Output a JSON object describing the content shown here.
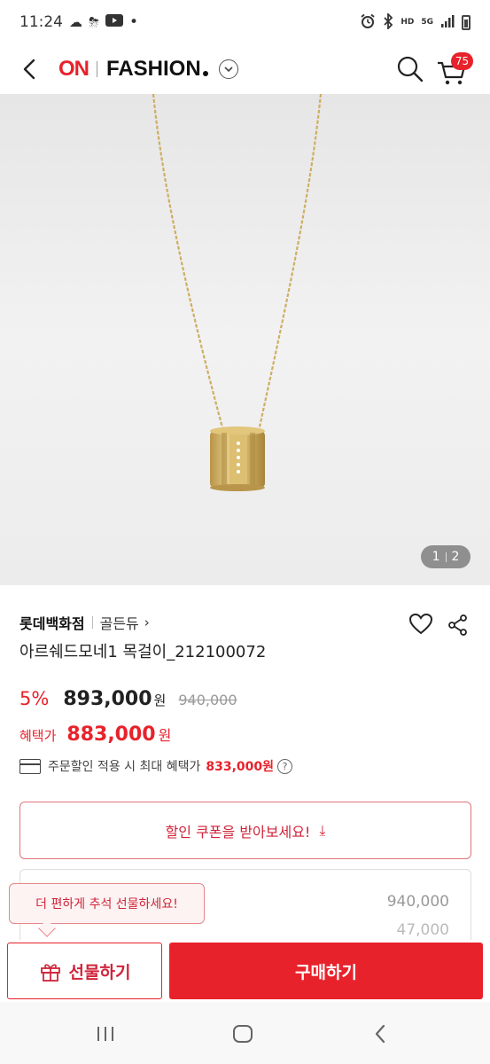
{
  "status_bar": {
    "time": "11:24",
    "left_icons": [
      "cloud-icon",
      "weather-icon",
      "youtube-icon"
    ],
    "dot": "•",
    "right_icons": [
      "alarm-icon",
      "bluetooth-icon",
      "hd-voice-icon",
      "5g-icon",
      "signal-icon",
      "battery-icon"
    ],
    "hd_label": "HD",
    "net_label": "5G"
  },
  "header": {
    "logo_on": "ON",
    "logo_fashion": "FASHION",
    "cart_count": "75"
  },
  "gallery": {
    "current": "1",
    "total": "2"
  },
  "product": {
    "brand": "롯데백화점",
    "sub_brand": "골든듀",
    "brand_chevron": "›",
    "title": "아르쉐드모네1 목걸이_212100072"
  },
  "pricing": {
    "discount": "5%",
    "price": "893,000",
    "won": "원",
    "original_price": "940,000",
    "benefit_label": "혜택가",
    "benefit_price": "883,000",
    "benefit_won": "원",
    "max_benefit_text": "주문할인 적용 시 최대 혜택가",
    "max_benefit_price": "833,000원",
    "help_mark": "?"
  },
  "coupon": {
    "label": "할인 쿠폰을 받아보세요!",
    "download_glyph": "⤓"
  },
  "price_box": {
    "value1": "940,000",
    "value2": "47,000"
  },
  "tooltip": {
    "text": "더 편하게 추석 선물하세요!"
  },
  "actions": {
    "gift_label": "선물하기",
    "buy_label": "구매하기"
  },
  "colors": {
    "accent": "#e8222b",
    "gold": "#d4b362"
  }
}
